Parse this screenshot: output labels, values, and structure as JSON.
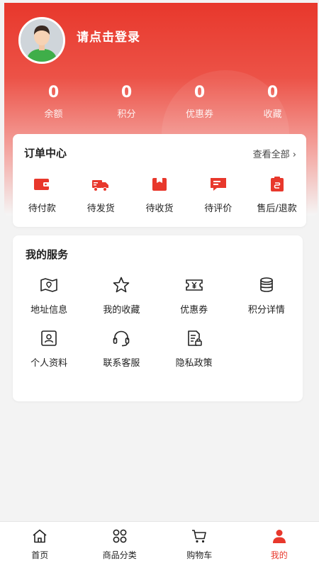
{
  "header": {
    "login_text": "请点击登录",
    "stats": [
      {
        "value": "0",
        "label": "余额"
      },
      {
        "value": "0",
        "label": "积分"
      },
      {
        "value": "0",
        "label": "优惠券"
      },
      {
        "value": "0",
        "label": "收藏"
      }
    ]
  },
  "orders": {
    "title": "订单中心",
    "view_all": "查看全部 ›",
    "items": [
      {
        "label": "待付款",
        "icon": "wallet-icon"
      },
      {
        "label": "待发货",
        "icon": "truck-icon"
      },
      {
        "label": "待收货",
        "icon": "package-icon"
      },
      {
        "label": "待评价",
        "icon": "comment-icon"
      },
      {
        "label": "售后/退款",
        "icon": "refund-icon"
      }
    ]
  },
  "services": {
    "title": "我的服务",
    "items": [
      {
        "label": "地址信息",
        "icon": "map-icon"
      },
      {
        "label": "我的收藏",
        "icon": "star-icon"
      },
      {
        "label": "优惠券",
        "icon": "coupon-icon"
      },
      {
        "label": "积分详情",
        "icon": "coins-icon"
      },
      {
        "label": "个人资料",
        "icon": "profile-icon"
      },
      {
        "label": "联系客服",
        "icon": "headset-icon"
      },
      {
        "label": "隐私政策",
        "icon": "document-lock-icon"
      }
    ]
  },
  "tabbar": {
    "tabs": [
      {
        "label": "首页",
        "icon": "home-icon"
      },
      {
        "label": "商品分类",
        "icon": "grid-icon"
      },
      {
        "label": "购物车",
        "icon": "cart-icon"
      },
      {
        "label": "我的",
        "icon": "user-icon",
        "active": true
      }
    ]
  },
  "colors": {
    "accent": "#e8382c",
    "background": "#f3f3f3"
  }
}
